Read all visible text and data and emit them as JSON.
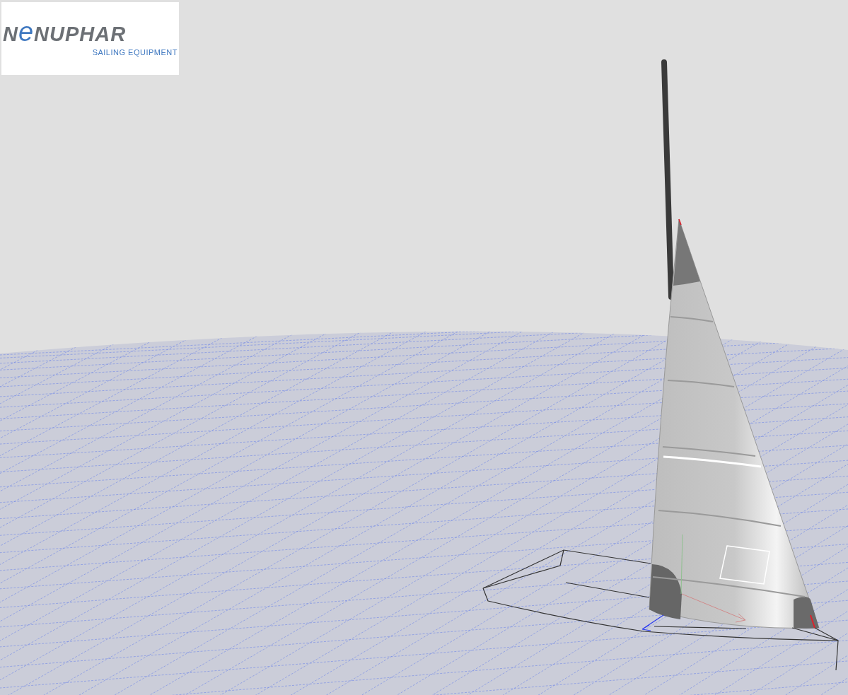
{
  "logo": {
    "wordmark_parts": [
      "N",
      "e",
      "NUPHAR"
    ],
    "tagline": "SAILING EQUIPMENT"
  }
}
